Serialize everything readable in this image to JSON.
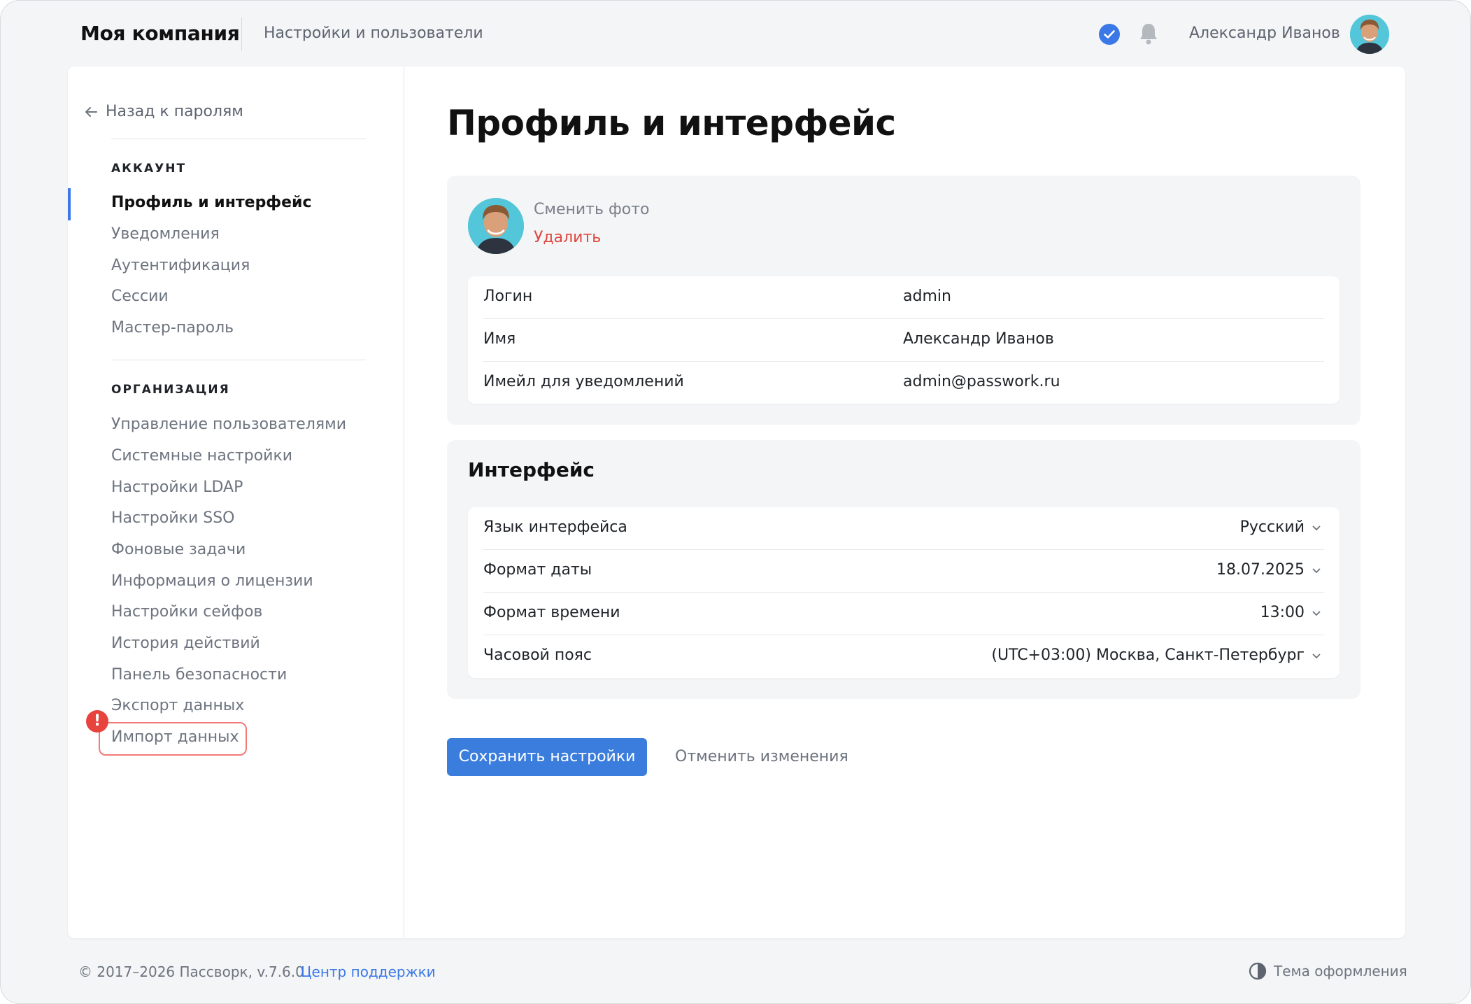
{
  "header": {
    "brand": "Моя компания",
    "nav_label": "Настройки и пользователи",
    "user_name": "Александр Иванов"
  },
  "sidebar": {
    "back_label": "Назад к паролям",
    "account_section": "АККАУНТ",
    "account_items": [
      {
        "label": "Профиль и интерфейс",
        "active": true
      },
      {
        "label": "Уведомления"
      },
      {
        "label": "Аутентификация"
      },
      {
        "label": "Сессии"
      },
      {
        "label": "Мастер-пароль"
      }
    ],
    "org_section": "ОРГАНИЗАЦИЯ",
    "org_items": [
      {
        "label": "Управление пользователями"
      },
      {
        "label": "Системные настройки"
      },
      {
        "label": "Настройки LDAP"
      },
      {
        "label": "Настройки SSO"
      },
      {
        "label": "Фоновые задачи"
      },
      {
        "label": "Информация о лицензии"
      },
      {
        "label": "Настройки сейфов"
      },
      {
        "label": "История действий"
      },
      {
        "label": "Панель безопасности"
      },
      {
        "label": "Экспорт данных"
      },
      {
        "label": "Импорт данных",
        "alert": true
      }
    ],
    "alert_mark": "!"
  },
  "main": {
    "title": "Профиль и интерфейс",
    "photo": {
      "change_label": "Сменить фото",
      "delete_label": "Удалить"
    },
    "profile_rows": [
      {
        "label": "Логин",
        "value": "admin"
      },
      {
        "label": "Имя",
        "value": "Александр Иванов"
      },
      {
        "label": "Имейл для уведомлений",
        "value": "admin@passwork.ru"
      }
    ],
    "interface": {
      "heading": "Интерфейс",
      "rows": [
        {
          "label": "Язык интерфейса",
          "value": "Русский"
        },
        {
          "label": "Формат даты",
          "value": "18.07.2025"
        },
        {
          "label": "Формат времени",
          "value": "13:00"
        },
        {
          "label": "Часовой пояс",
          "value": "(UTC+03:00) Москва, Санкт-Петербург"
        }
      ]
    },
    "save_label": "Сохранить настройки",
    "cancel_label": "Отменить изменения"
  },
  "footer": {
    "copyright": "© 2017–2026 Пассворк, v.7.6.0",
    "support_label": "Центр поддержки",
    "theme_label": "Тема оформления"
  },
  "colors": {
    "accent": "#3b78e7",
    "danger": "#e0463f",
    "background": "#f4f5f7"
  },
  "icons": [
    "verified-check-icon",
    "bell-icon",
    "back-arrow-icon",
    "chevron-down-icon",
    "theme-contrast-icon",
    "alert-icon"
  ]
}
